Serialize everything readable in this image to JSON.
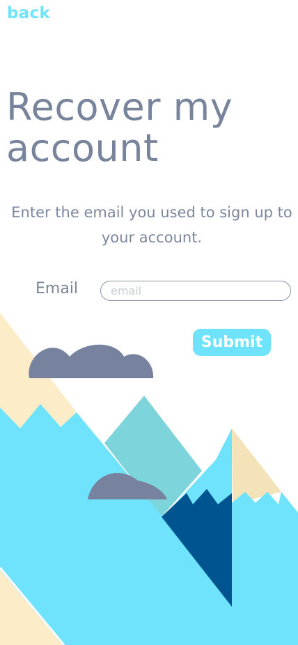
{
  "nav": {
    "back_label": "back"
  },
  "header": {
    "title": "Recover my account"
  },
  "form": {
    "instructions": "Enter the email you used to sign up to your account.",
    "email_label": "Email",
    "email_placeholder": "email",
    "email_value": "",
    "submit_label": "Submit"
  },
  "colors": {
    "accent": "#6fe3fb",
    "text": "#78849c",
    "cloud": "#76829e",
    "sand": "#fdecc8",
    "teal": "#7dd4db",
    "navy": "#00548f"
  },
  "illustration": {
    "icon": "mountain-landscape-illustration"
  }
}
